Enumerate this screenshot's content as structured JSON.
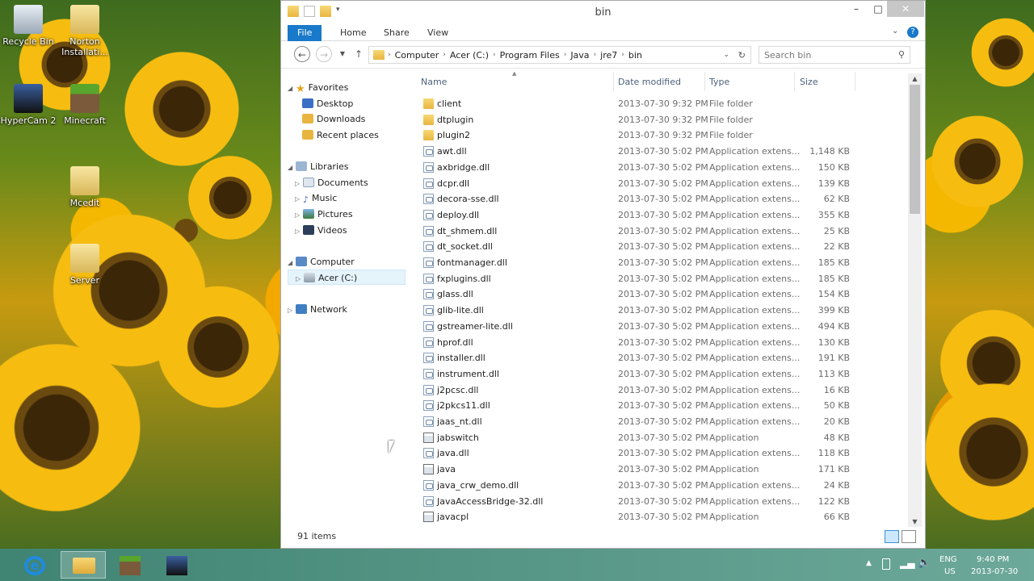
{
  "desktop": {
    "icons": [
      {
        "label": "Recycle Bin",
        "icon": "recycle-bin-icon"
      },
      {
        "label": "Norton Installati...",
        "icon": "folder-shortcut-icon"
      },
      {
        "label": "HyperCam 2",
        "icon": "hypercam-icon"
      },
      {
        "label": "Minecraft",
        "icon": "minecraft-icon"
      },
      {
        "label": "Mcedit",
        "icon": "folder-icon"
      },
      {
        "label": "Server",
        "icon": "folder-icon"
      }
    ]
  },
  "window": {
    "title": "bin",
    "ribbon_tabs": [
      "File",
      "Home",
      "Share",
      "View"
    ],
    "address": [
      "Computer",
      "Acer (C:)",
      "Program Files",
      "Java",
      "jre7",
      "bin"
    ],
    "search_placeholder": "Search bin",
    "colors": {
      "accent": "#1979ca",
      "selected": "#e5f3fb"
    }
  },
  "nav": {
    "favorites": "Favorites",
    "favorites_items": [
      "Desktop",
      "Downloads",
      "Recent places"
    ],
    "libraries": "Libraries",
    "libraries_items": [
      "Documents",
      "Music",
      "Pictures",
      "Videos"
    ],
    "computer": "Computer",
    "computer_items": [
      "Acer (C:)"
    ],
    "network": "Network"
  },
  "columns": [
    "Name",
    "Date modified",
    "Type",
    "Size"
  ],
  "files": [
    {
      "name": "client",
      "date": "2013-07-30 9:32 PM",
      "type": "File folder",
      "size": "",
      "kind": "folder"
    },
    {
      "name": "dtplugin",
      "date": "2013-07-30 9:32 PM",
      "type": "File folder",
      "size": "",
      "kind": "folder"
    },
    {
      "name": "plugin2",
      "date": "2013-07-30 9:32 PM",
      "type": "File folder",
      "size": "",
      "kind": "folder"
    },
    {
      "name": "awt.dll",
      "date": "2013-07-30 5:02 PM",
      "type": "Application extens...",
      "size": "1,148 KB",
      "kind": "dll"
    },
    {
      "name": "axbridge.dll",
      "date": "2013-07-30 5:02 PM",
      "type": "Application extens...",
      "size": "150 KB",
      "kind": "dll"
    },
    {
      "name": "dcpr.dll",
      "date": "2013-07-30 5:02 PM",
      "type": "Application extens...",
      "size": "139 KB",
      "kind": "dll"
    },
    {
      "name": "decora-sse.dll",
      "date": "2013-07-30 5:02 PM",
      "type": "Application extens...",
      "size": "62 KB",
      "kind": "dll"
    },
    {
      "name": "deploy.dll",
      "date": "2013-07-30 5:02 PM",
      "type": "Application extens...",
      "size": "355 KB",
      "kind": "dll"
    },
    {
      "name": "dt_shmem.dll",
      "date": "2013-07-30 5:02 PM",
      "type": "Application extens...",
      "size": "25 KB",
      "kind": "dll"
    },
    {
      "name": "dt_socket.dll",
      "date": "2013-07-30 5:02 PM",
      "type": "Application extens...",
      "size": "22 KB",
      "kind": "dll"
    },
    {
      "name": "fontmanager.dll",
      "date": "2013-07-30 5:02 PM",
      "type": "Application extens...",
      "size": "185 KB",
      "kind": "dll"
    },
    {
      "name": "fxplugins.dll",
      "date": "2013-07-30 5:02 PM",
      "type": "Application extens...",
      "size": "185 KB",
      "kind": "dll"
    },
    {
      "name": "glass.dll",
      "date": "2013-07-30 5:02 PM",
      "type": "Application extens...",
      "size": "154 KB",
      "kind": "dll"
    },
    {
      "name": "glib-lite.dll",
      "date": "2013-07-30 5:02 PM",
      "type": "Application extens...",
      "size": "399 KB",
      "kind": "dll"
    },
    {
      "name": "gstreamer-lite.dll",
      "date": "2013-07-30 5:02 PM",
      "type": "Application extens...",
      "size": "494 KB",
      "kind": "dll"
    },
    {
      "name": "hprof.dll",
      "date": "2013-07-30 5:02 PM",
      "type": "Application extens...",
      "size": "130 KB",
      "kind": "dll"
    },
    {
      "name": "installer.dll",
      "date": "2013-07-30 5:02 PM",
      "type": "Application extens...",
      "size": "191 KB",
      "kind": "dll"
    },
    {
      "name": "instrument.dll",
      "date": "2013-07-30 5:02 PM",
      "type": "Application extens...",
      "size": "113 KB",
      "kind": "dll"
    },
    {
      "name": "j2pcsc.dll",
      "date": "2013-07-30 5:02 PM",
      "type": "Application extens...",
      "size": "16 KB",
      "kind": "dll"
    },
    {
      "name": "j2pkcs11.dll",
      "date": "2013-07-30 5:02 PM",
      "type": "Application extens...",
      "size": "50 KB",
      "kind": "dll"
    },
    {
      "name": "jaas_nt.dll",
      "date": "2013-07-30 5:02 PM",
      "type": "Application extens...",
      "size": "20 KB",
      "kind": "dll"
    },
    {
      "name": "jabswitch",
      "date": "2013-07-30 5:02 PM",
      "type": "Application",
      "size": "48 KB",
      "kind": "app"
    },
    {
      "name": "java.dll",
      "date": "2013-07-30 5:02 PM",
      "type": "Application extens...",
      "size": "118 KB",
      "kind": "dll"
    },
    {
      "name": "java",
      "date": "2013-07-30 5:02 PM",
      "type": "Application",
      "size": "171 KB",
      "kind": "app"
    },
    {
      "name": "java_crw_demo.dll",
      "date": "2013-07-30 5:02 PM",
      "type": "Application extens...",
      "size": "24 KB",
      "kind": "dll"
    },
    {
      "name": "JavaAccessBridge-32.dll",
      "date": "2013-07-30 5:02 PM",
      "type": "Application extens...",
      "size": "122 KB",
      "kind": "dll"
    },
    {
      "name": "javacpl",
      "date": "2013-07-30 5:02 PM",
      "type": "Application",
      "size": "66 KB",
      "kind": "app"
    }
  ],
  "status": {
    "item_count": "91 items"
  },
  "taskbar": {
    "lang_top": "ENG",
    "lang_bottom": "US",
    "time": "9:40 PM",
    "date": "2013-07-30"
  }
}
